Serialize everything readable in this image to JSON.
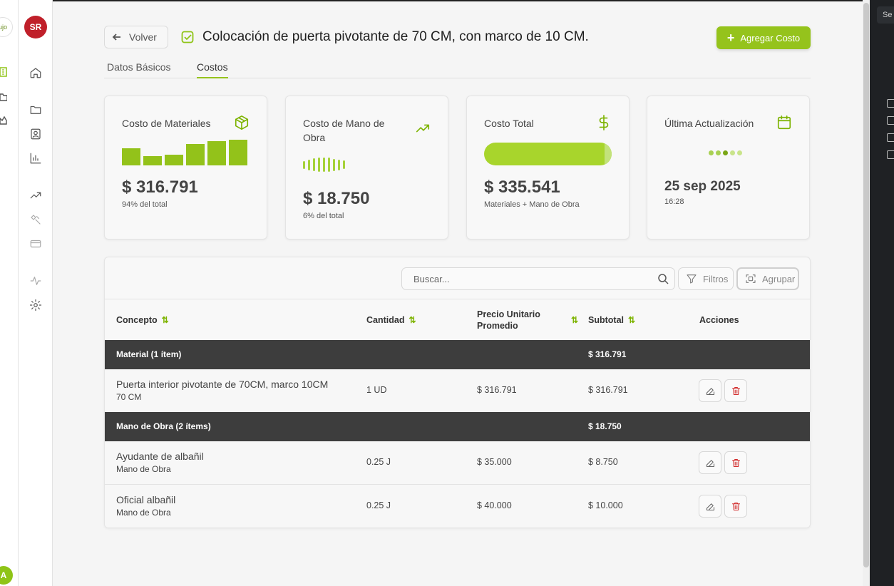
{
  "far_rail": {
    "logo_text": "ujo",
    "avatar": "A"
  },
  "rail": {
    "avatar_initials": "SR"
  },
  "header": {
    "back_label": "Volver",
    "title": "Colocación de puerta pivotante de 70 CM, con marco de 10 CM.",
    "add_button_label": "Agregar Costo"
  },
  "tabs": [
    {
      "label": "Datos Básicos",
      "active": false
    },
    {
      "label": "Costos",
      "active": true
    }
  ],
  "cards": {
    "materials": {
      "label": "Costo de Materiales",
      "value": "$ 316.791",
      "sub": "94% del total",
      "icon": "box-icon",
      "bar_levels": [
        0.68,
        0.37,
        0.42,
        0.82,
        0.95,
        1.0
      ]
    },
    "labor": {
      "label": "Costo de Mano de Obra",
      "value": "$ 18.750",
      "sub": "6% del total",
      "icon": "trending-up-icon",
      "pulse_levels": [
        0.55,
        0.75,
        0.9,
        1.0,
        1.0,
        1.0,
        0.85,
        0.75,
        0.6
      ]
    },
    "total": {
      "label": "Costo Total",
      "value": "$ 335.541",
      "sub": "Materiales + Mano de Obra",
      "icon": "dollar-icon",
      "fill": 0.94
    },
    "updated": {
      "label": "Última Actualización",
      "value": "25 sep 2025",
      "sub": "16:28",
      "icon": "calendar-icon",
      "dots_active": 3,
      "dots_total": 5
    }
  },
  "toolbar": {
    "search_placeholder": "Buscar...",
    "filters_label": "Filtros",
    "group_label": "Agrupar"
  },
  "table": {
    "columns": [
      "Concepto",
      "Cantidad",
      "Precio Unitario Promedio",
      "Subtotal",
      "Acciones"
    ],
    "groups": [
      {
        "title": "Material (1 ítem)",
        "subtotal": "$ 316.791",
        "rows": [
          {
            "concept": "Puerta interior pivotante de 70CM, marco 10CM",
            "detail": "70 CM",
            "quantity": "1 UD",
            "unit_price": "$ 316.791",
            "subtotal": "$ 316.791"
          }
        ]
      },
      {
        "title": "Mano de Obra (2 ítems)",
        "subtotal": "$ 18.750",
        "rows": [
          {
            "concept": "Ayudante de albañil",
            "detail": "Mano de Obra",
            "quantity": "0.25 J",
            "unit_price": "$ 35.000",
            "subtotal": "$ 8.750"
          },
          {
            "concept": "Oficial albañil",
            "detail": "Mano de Obra",
            "quantity": "0.25 J",
            "unit_price": "$ 40.000",
            "subtotal": "$ 10.000"
          }
        ]
      }
    ]
  },
  "dark_panel": {
    "search_text": "Se"
  },
  "colors": {
    "accent": "#95c31c",
    "group_row_bg": "#3d3d3d",
    "danger": "#d12b2b"
  }
}
